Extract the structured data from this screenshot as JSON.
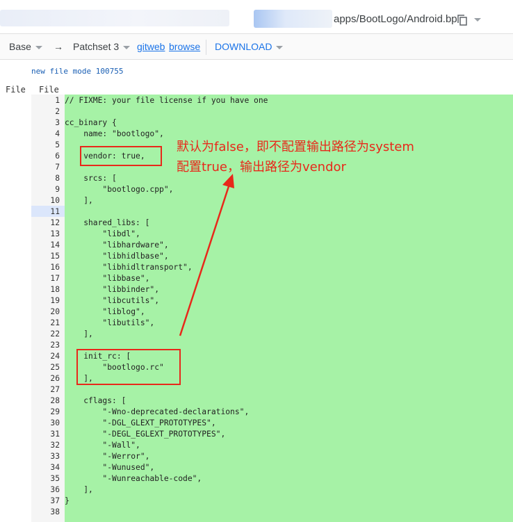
{
  "header": {
    "path": "apps/BootLogo/Android.bp"
  },
  "toolbar": {
    "base_label": "Base",
    "arrow": "→",
    "patchset_label": "Patchset 3",
    "gitweb_label": "gitweb",
    "browse_label": "browse",
    "download_label": "DOWNLOAD"
  },
  "diff": {
    "new_file_mode": "new file mode 100755",
    "left_header": "File",
    "right_header": "File",
    "lines": [
      {
        "n": "1",
        "t": "// FIXME: your file license if you have one"
      },
      {
        "n": "2",
        "t": ""
      },
      {
        "n": "3",
        "t": "cc_binary {"
      },
      {
        "n": "4",
        "t": "    name: \"bootlogo\","
      },
      {
        "n": "5",
        "t": ""
      },
      {
        "n": "6",
        "t": "    vendor: true,"
      },
      {
        "n": "7",
        "t": ""
      },
      {
        "n": "8",
        "t": "    srcs: ["
      },
      {
        "n": "9",
        "t": "        \"bootlogo.cpp\","
      },
      {
        "n": "10",
        "t": "    ],"
      },
      {
        "n": "11",
        "t": ""
      },
      {
        "n": "12",
        "t": "    shared_libs: ["
      },
      {
        "n": "13",
        "t": "        \"libdl\","
      },
      {
        "n": "14",
        "t": "        \"libhardware\","
      },
      {
        "n": "15",
        "t": "        \"libhidlbase\","
      },
      {
        "n": "16",
        "t": "        \"libhidltransport\","
      },
      {
        "n": "17",
        "t": "        \"libbase\","
      },
      {
        "n": "18",
        "t": "        \"libbinder\","
      },
      {
        "n": "19",
        "t": "        \"libcutils\","
      },
      {
        "n": "20",
        "t": "        \"liblog\","
      },
      {
        "n": "21",
        "t": "        \"libutils\","
      },
      {
        "n": "22",
        "t": "    ],"
      },
      {
        "n": "23",
        "t": ""
      },
      {
        "n": "24",
        "t": "    init_rc: ["
      },
      {
        "n": "25",
        "t": "        \"bootlogo.rc\""
      },
      {
        "n": "26",
        "t": "    ],"
      },
      {
        "n": "27",
        "t": ""
      },
      {
        "n": "28",
        "t": "    cflags: ["
      },
      {
        "n": "29",
        "t": "        \"-Wno-deprecated-declarations\","
      },
      {
        "n": "30",
        "t": "        \"-DGL_GLEXT_PROTOTYPES\","
      },
      {
        "n": "31",
        "t": "        \"-DEGL_EGLEXT_PROTOTYPES\","
      },
      {
        "n": "32",
        "t": "        \"-Wall\","
      },
      {
        "n": "33",
        "t": "        \"-Werror\","
      },
      {
        "n": "34",
        "t": "        \"-Wunused\","
      },
      {
        "n": "35",
        "t": "        \"-Wunreachable-code\","
      },
      {
        "n": "36",
        "t": "    ],"
      },
      {
        "n": "37",
        "t": "}"
      },
      {
        "n": "38",
        "t": ""
      }
    ]
  },
  "annotation": {
    "line1": "默认为false，即不配置输出路径为system",
    "line2": "配置true，输出路径为vendor"
  },
  "colors": {
    "added_bg": "#a6f2a6",
    "annotation_red": "#e8281a",
    "link_blue": "#1a73e8"
  }
}
